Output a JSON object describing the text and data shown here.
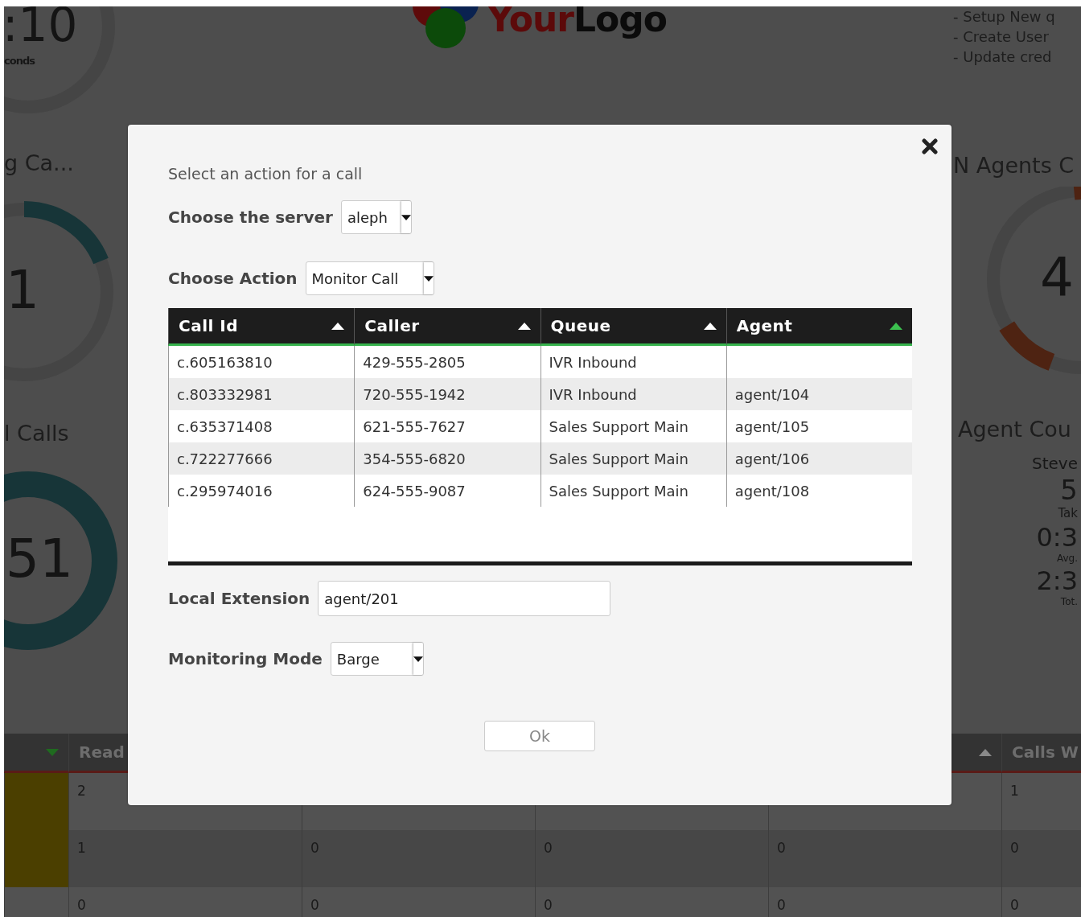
{
  "dashboard": {
    "left_panel": {
      "timer": {
        "value": ":10",
        "unit": "conds"
      },
      "gauges": [
        {
          "title": "g Ca...",
          "value": "1",
          "kind": "partial"
        },
        {
          "title": "l Calls",
          "value": "51",
          "kind": "full"
        }
      ]
    },
    "logo": {
      "parts": [
        "Your",
        "Logo"
      ]
    },
    "right_panel": {
      "notes": [
        "- Setup New q",
        "- Create User",
        "- Update cred"
      ],
      "gauge": {
        "title": "N Agents C",
        "value": "4"
      },
      "agent_card": {
        "title": "Agent Cou",
        "name": "Steve",
        "stats": [
          {
            "value": "5",
            "label": "Tak"
          },
          {
            "value": "0:3",
            "label": "Avg."
          },
          {
            "value": "2:3",
            "label": "Tot."
          }
        ]
      }
    },
    "queue_table": {
      "columns": [
        {
          "descending": true,
          "active": true
        },
        {
          "label": "Read"
        },
        {},
        {},
        {
          "descending": false,
          "active": false
        },
        {
          "label": "Calls W"
        }
      ],
      "rows": [
        {
          "highlighted": true,
          "column_2": "2",
          "column_6": "1"
        },
        {
          "highlighted": true,
          "column_2": "1",
          "column_3": "0",
          "column_4": "0",
          "column_5": "0",
          "column_6": "0"
        },
        {
          "highlighted": false,
          "column_2": "0",
          "column_3": "0",
          "column_4": "0",
          "column_5": "0",
          "column_6": "0"
        }
      ]
    }
  },
  "dialog": {
    "prompt": "Select an action for a call",
    "server": {
      "label": "Choose the server",
      "value": "aleph"
    },
    "action": {
      "label": "Choose Action",
      "value": "Monitor Call"
    },
    "calls_table": {
      "columns": [
        {
          "label": "Call Id",
          "active": false
        },
        {
          "label": "Caller",
          "active": false
        },
        {
          "label": "Queue",
          "active": false
        },
        {
          "label": "Agent",
          "active": true
        }
      ],
      "rows": [
        {
          "call_id": "c.605163810",
          "caller": "429-555-2805",
          "queue": "IVR Inbound"
        },
        {
          "call_id": "c.803332981",
          "caller": "720-555-1942",
          "queue": "IVR Inbound",
          "agent": "agent/104"
        },
        {
          "call_id": "c.635371408",
          "caller": "621-555-7627",
          "queue": "Sales Support Main",
          "agent": "agent/105"
        },
        {
          "call_id": "c.722277666",
          "caller": "354-555-6820",
          "queue": "Sales Support Main",
          "agent": "agent/106"
        },
        {
          "call_id": "c.295974016",
          "caller": "624-555-9087",
          "queue": "Sales Support Main",
          "agent": "agent/108"
        }
      ]
    },
    "extension": {
      "label": "Local Extension",
      "value": "agent/201"
    },
    "mode": {
      "label": "Monitoring Mode",
      "value": "Barge"
    },
    "ok_button": {
      "label": "Ok",
      "disabled": true
    }
  }
}
